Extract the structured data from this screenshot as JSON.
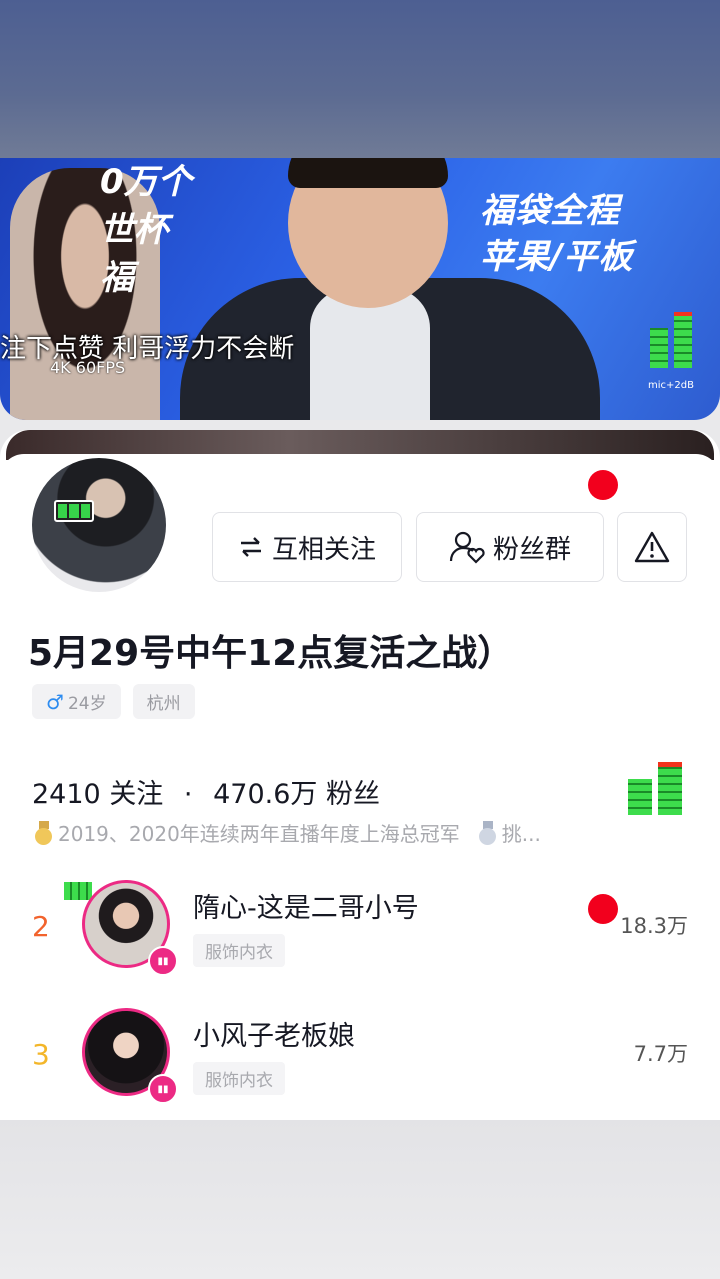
{
  "stream": {
    "subtitle": "注下点赞 利哥浮力不会断",
    "resolution": "4K 60FPS",
    "promo_right": [
      "福袋全程",
      "苹果/平板"
    ],
    "promo_left": [
      "0万个",
      "世杯",
      "福"
    ],
    "mic_label": "mic+2dB"
  },
  "profile": {
    "mutual_follow_label": "互相关注",
    "fans_group_label": "粉丝群",
    "name": "5月29号中午12点复活之战）",
    "tags": {
      "age": "24岁",
      "city": "杭州"
    },
    "following_count": "2410",
    "following_label": "关注",
    "followers_count": "470.6万",
    "followers_label": "粉丝",
    "honor_text": "2019、2020年连续两年直播年度上海总冠军",
    "honor_more": "挑..."
  },
  "ranking": [
    {
      "rank": "2",
      "title": "隋心-这是二哥小号",
      "tag": "服饰内衣",
      "count": "18.3万"
    },
    {
      "rank": "3",
      "title": "小风子老板娘",
      "tag": "服饰内衣",
      "count": "7.7万"
    }
  ],
  "icons": {
    "mutual": "swap-arrows-icon",
    "fans_group": "users-heart-icon",
    "report": "warning-icon"
  },
  "colors": {
    "accent_red": "#f2001d",
    "live_pink": "#ec2a84",
    "rank2": "#f2632d",
    "rank3": "#f3b62a"
  }
}
